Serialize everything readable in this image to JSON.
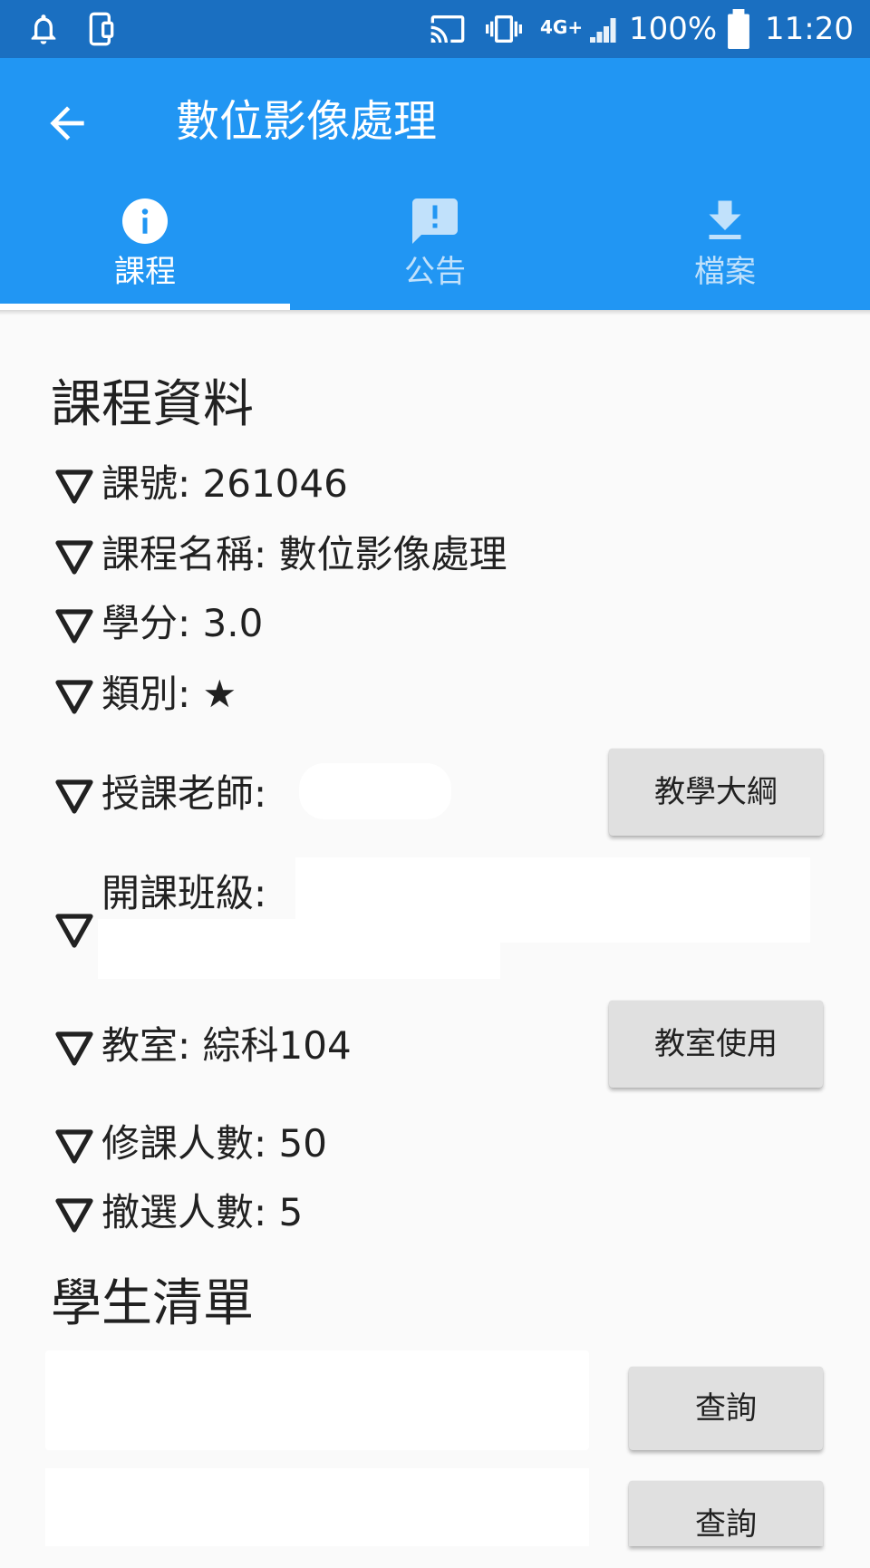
{
  "status_bar": {
    "battery": "100%",
    "time": "11:20",
    "network": "4G+",
    "icons": [
      "bell-icon",
      "phone-icon",
      "cast-icon",
      "vibrate-icon",
      "signal-icon",
      "battery-icon"
    ]
  },
  "app_bar": {
    "title": "數位影像處理",
    "back_icon": "arrow-back-icon"
  },
  "tabs": [
    {
      "label": "課程",
      "icon": "info-icon",
      "selected": true
    },
    {
      "label": "公告",
      "icon": "announcement-icon",
      "selected": false
    },
    {
      "label": "檔案",
      "icon": "download-icon",
      "selected": false
    }
  ],
  "course_info": {
    "heading": "課程資料",
    "course_no": "課號: 261046",
    "course_name": "課程名稱: 數位影像處理",
    "credits": "學分: 3.0",
    "category": "類別: ★",
    "teacher": "授課老師:",
    "syllabus_button": "教學大綱",
    "class": "開課班級:",
    "classroom": "教室: 綜科104",
    "classroom_button": "教室使用",
    "enrolled": "修課人數: 50",
    "withdrawn": "撤選人數: 5"
  },
  "student_list": {
    "heading": "學生清單",
    "query_button_1": "查詢",
    "query_button_2": "查詢"
  },
  "colors": {
    "status_bar": "#1a6fc1",
    "primary": "#2196f3",
    "background": "#fafafa",
    "button": "#e0e0e0"
  }
}
